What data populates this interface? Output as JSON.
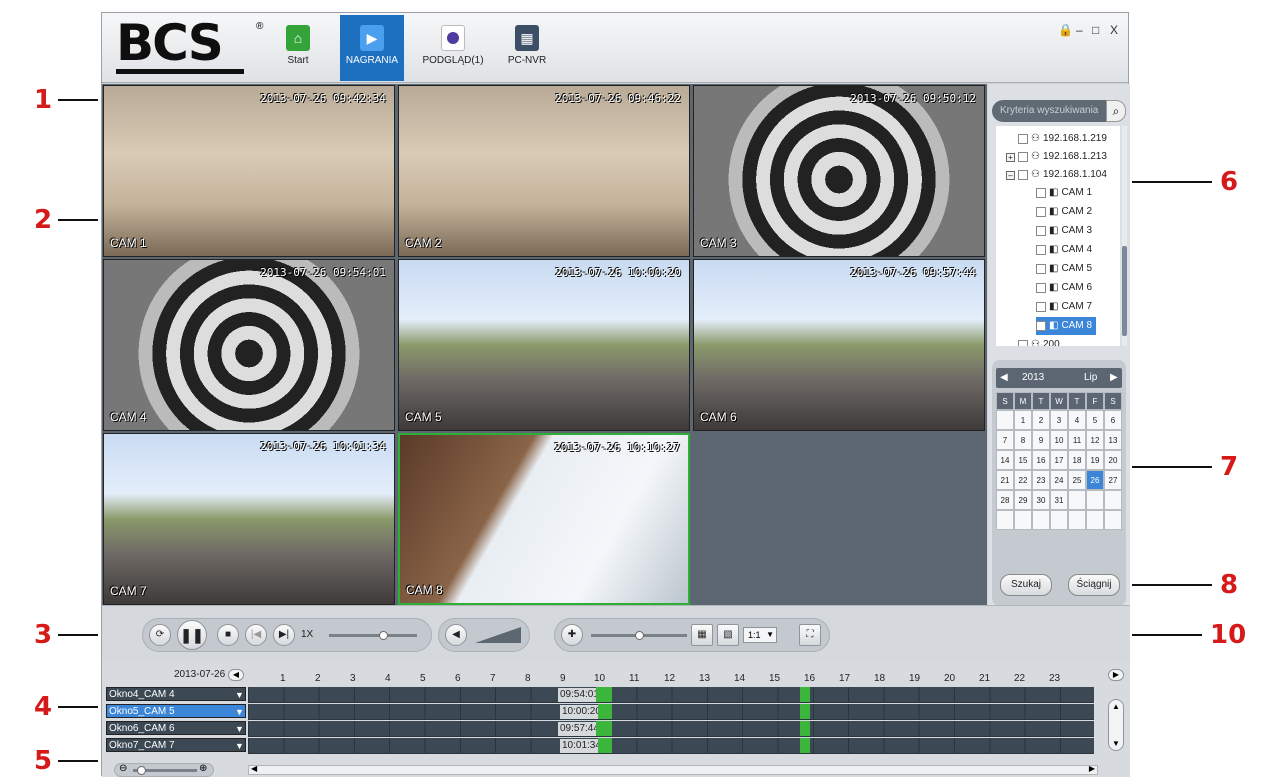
{
  "annotations": [
    "1",
    "2",
    "3",
    "4",
    "5",
    "6",
    "7",
    "8",
    "10"
  ],
  "header": {
    "logo": "BCS",
    "logo_reg": "®",
    "tabs": [
      {
        "label": "Start",
        "icon": "home-icon"
      },
      {
        "label": "NAGRANIA",
        "icon": "playback-icon"
      },
      {
        "label": "PODGLĄD(1)",
        "icon": "preview-icon"
      },
      {
        "label": "PC-NVR",
        "icon": "pc-nvr-icon"
      }
    ],
    "window_controls": {
      "lock": "🔒",
      "minimize": "–",
      "maximize": "□",
      "close": "X"
    }
  },
  "video_cells": [
    {
      "timestamp": "2013-07-26 09:42:34",
      "cam": "CAM 1",
      "scene": "room"
    },
    {
      "timestamp": "2013-07-26 09:46:22",
      "cam": "CAM 2",
      "scene": "room"
    },
    {
      "timestamp": "2013-07-26 09:50:12",
      "cam": "CAM 3",
      "scene": "spiral"
    },
    {
      "timestamp": "2013-07-26 09:54:01",
      "cam": "CAM 4",
      "scene": "spiral"
    },
    {
      "timestamp": "2013-07-26 10:00:20",
      "cam": "CAM 5",
      "scene": "park"
    },
    {
      "timestamp": "2013-07-26 09:57:44",
      "cam": "CAM 6",
      "scene": "park"
    },
    {
      "timestamp": "2013-07-26 10:01:34",
      "cam": "CAM 7",
      "scene": "park"
    },
    {
      "timestamp": "2013-07-26 10:10:27",
      "cam": "CAM 8",
      "scene": "window"
    }
  ],
  "right_panel": {
    "search_placeholder": "Kryteria wyszukiwania",
    "tree": [
      {
        "label": "192.168.1.219",
        "level": 0,
        "expander": ""
      },
      {
        "label": "192.168.1.213",
        "level": 0,
        "expander": "+"
      },
      {
        "label": "192.168.1.104",
        "level": 0,
        "expander": "–"
      },
      {
        "label": "CAM 1",
        "level": 1
      },
      {
        "label": "CAM 2",
        "level": 1
      },
      {
        "label": "CAM 3",
        "level": 1
      },
      {
        "label": "CAM 4",
        "level": 1
      },
      {
        "label": "CAM 5",
        "level": 1
      },
      {
        "label": "CAM 6",
        "level": 1
      },
      {
        "label": "CAM 7",
        "level": 1
      },
      {
        "label": "CAM 8",
        "level": 1,
        "selected": true
      },
      {
        "label": "200",
        "level": 0,
        "expander": ""
      }
    ],
    "calendar": {
      "year": "2013",
      "month": "Lip",
      "dow": [
        "S",
        "M",
        "T",
        "W",
        "T",
        "F",
        "S"
      ],
      "weeks": [
        [
          "",
          "1",
          "2",
          "3",
          "4",
          "5",
          "6"
        ],
        [
          "7",
          "8",
          "9",
          "10",
          "11",
          "12",
          "13"
        ],
        [
          "14",
          "15",
          "16",
          "17",
          "18",
          "19",
          "20"
        ],
        [
          "21",
          "22",
          "23",
          "24",
          "25",
          "26",
          "27"
        ],
        [
          "28",
          "29",
          "30",
          "31",
          "",
          "",
          ""
        ],
        [
          "",
          "",
          "",
          "",
          "",
          "",
          ""
        ]
      ],
      "selected_day": "26"
    },
    "search_button": "Szukaj",
    "download_button": "Ściągnij"
  },
  "controls": {
    "speed": "1X",
    "ratio": "1:1"
  },
  "timeline": {
    "date": "2013-07-26",
    "hours": [
      "1",
      "2",
      "3",
      "4",
      "5",
      "6",
      "7",
      "8",
      "9",
      "10",
      "11",
      "12",
      "13",
      "14",
      "15",
      "16",
      "17",
      "18",
      "19",
      "20",
      "21",
      "22",
      "23"
    ],
    "rows": [
      {
        "label": "Okno4_CAM 4",
        "time": "09:54:01",
        "selected": false
      },
      {
        "label": "Okno5_CAM 5",
        "time": "10:00:20",
        "selected": true
      },
      {
        "label": "Okno6_CAM 6",
        "time": "09:57:44",
        "selected": false
      },
      {
        "label": "Okno7_CAM 7",
        "time": "10:01:34",
        "selected": false
      }
    ]
  }
}
